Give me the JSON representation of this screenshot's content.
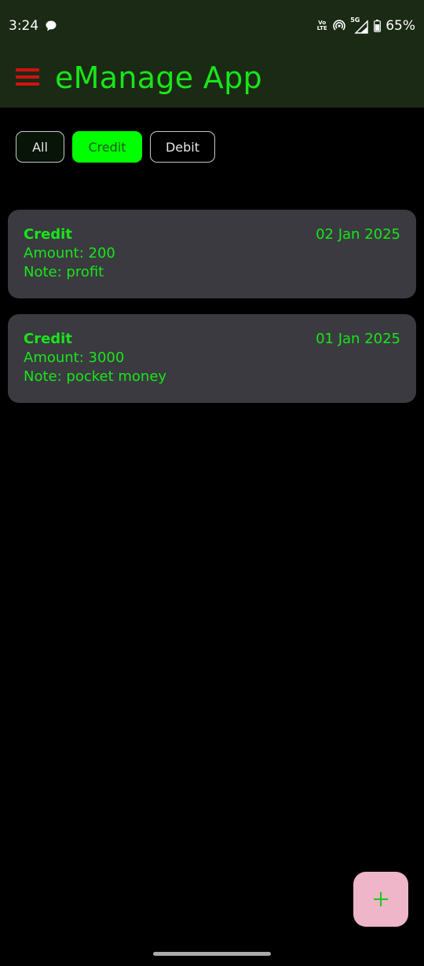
{
  "status_bar": {
    "time": "3:24",
    "network_label_top": "Vo",
    "network_label_bottom": "LTE",
    "signal_label": "5G",
    "battery": "65%"
  },
  "app_bar": {
    "title": "eManage App",
    "menu_icon": "hamburger-menu-icon"
  },
  "filters": {
    "all_label": "All",
    "credit_label": "Credit",
    "debit_label": "Debit",
    "selected": "Credit"
  },
  "transactions": [
    {
      "type": "Credit",
      "date": "02 Jan 2025",
      "amount": "Amount: 200",
      "note": "Note: profit"
    },
    {
      "type": "Credit",
      "date": "01 Jan 2025",
      "amount": "Amount: 3000",
      "note": "Note: pocket money"
    }
  ],
  "fab": {
    "icon": "plus-icon"
  },
  "colors": {
    "accent_green": "#19e619",
    "selected_chip": "#00ff00",
    "menu_red": "#d41010",
    "card_bg": "#3a3a40",
    "fab_bg": "#efb5c8",
    "bar_bg": "#1b2a14"
  }
}
